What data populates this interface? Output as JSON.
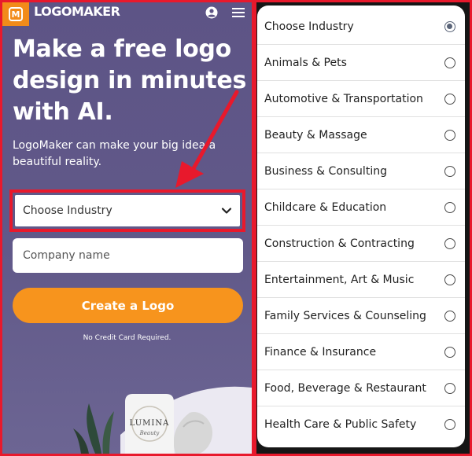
{
  "brand": {
    "logo_letter": "M",
    "name": "LOGOMAKER"
  },
  "hero": {
    "headline_lines": [
      "Make a free logo",
      "design in minutes",
      "with AI."
    ],
    "subtext_lines": [
      "LogoMaker can make your big idea a",
      "beautiful reality."
    ],
    "product_label": "LUMINA",
    "product_sublabel": "Beauty"
  },
  "form": {
    "industry_selected": "Choose Industry",
    "company_placeholder": "Company name",
    "cta_label": "Create a Logo",
    "note": "No Credit Card Required."
  },
  "industry_options": [
    "Choose Industry",
    "Animals & Pets",
    "Automotive & Transportation",
    "Beauty & Massage",
    "Business & Consulting",
    "Childcare & Education",
    "Construction & Contracting",
    "Entertainment, Art & Music",
    "Family Services & Counseling",
    "Finance & Insurance",
    "Food, Beverage & Restaurant",
    "Health Care & Public Safety"
  ],
  "selected_option_index": 0,
  "colors": {
    "accent_orange": "#f7941d",
    "highlight_red": "#e8192c",
    "panel_purple": "#5d5486"
  },
  "icons": {
    "user": "user-circle-icon",
    "menu": "hamburger-menu-icon",
    "dropdown": "chevron-down-icon"
  }
}
